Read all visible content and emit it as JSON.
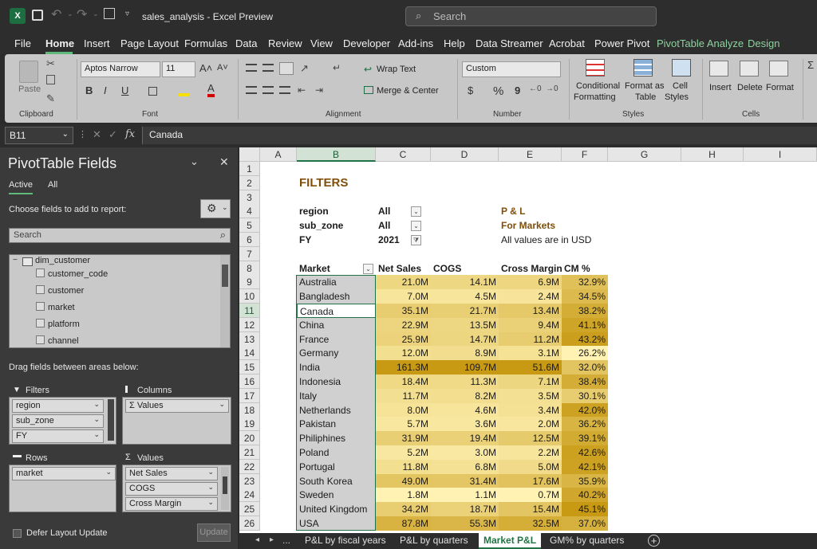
{
  "app": {
    "title": "sales_analysis  -  Excel Preview",
    "search_placeholder": "Search",
    "logo_letter": "X"
  },
  "menu": [
    "File",
    "Home",
    "Insert",
    "Page Layout",
    "Formulas",
    "Data",
    "Review",
    "View",
    "Developer",
    "Add-ins",
    "Help",
    "Data Streamer",
    "Acrobat",
    "Power Pivot",
    "PivotTable Analyze",
    "Design"
  ],
  "ribbon": {
    "clipboard": {
      "paste": "Paste",
      "group": "Clipboard"
    },
    "font": {
      "name": "Aptos Narrow",
      "size": "11",
      "bold": "B",
      "italic": "I",
      "underline": "U",
      "group": "Font"
    },
    "alignment": {
      "wrap": "Wrap Text",
      "merge": "Merge & Center",
      "group": "Alignment"
    },
    "number": {
      "format": "Custom",
      "currency": "$",
      "percent": "%",
      "comma": "9",
      "group": "Number"
    },
    "styles": {
      "conditional_1": "Conditional",
      "conditional_2": "Formatting",
      "format_table_1": "Format as",
      "format_table_2": "Table",
      "cell_styles_1": "Cell",
      "cell_styles_2": "Styles",
      "group": "Styles"
    },
    "cells": {
      "insert": "Insert",
      "delete": "Delete",
      "format": "Format",
      "group": "Cells"
    }
  },
  "formula_bar": {
    "name_box": "B11",
    "fx": "fx",
    "value": "Canada"
  },
  "pivot_pane": {
    "title": "PivotTable Fields",
    "tab_active": "Active",
    "tab_all": "All",
    "choose_label": "Choose fields to add to report:",
    "search_placeholder": "Search",
    "table_name": "dim_customer",
    "fields": [
      "customer_code",
      "customer",
      "market",
      "platform",
      "channel"
    ],
    "drag_label": "Drag fields between areas below:",
    "filters_label": "Filters",
    "columns_label": "Columns",
    "rows_label": "Rows",
    "values_label": "Values",
    "filters": [
      "region",
      "sub_zone",
      "FY"
    ],
    "columns": [
      "Values"
    ],
    "rows": [
      "market"
    ],
    "values": [
      "Net Sales",
      "COGS",
      "Cross Margin"
    ],
    "defer_label": "Defer Layout Update",
    "update_button": "Update"
  },
  "sheet": {
    "columns": [
      "A",
      "B",
      "C",
      "D",
      "E",
      "F",
      "G",
      "H",
      "I"
    ],
    "rows": [
      "1",
      "2",
      "3",
      "4",
      "5",
      "6",
      "7",
      "8",
      "9",
      "10",
      "11",
      "12",
      "13",
      "14",
      "15",
      "16",
      "17",
      "18",
      "19",
      "20",
      "21",
      "22",
      "23",
      "24",
      "25",
      "26"
    ],
    "filters_heading": "FILTERS",
    "filter_rows": [
      {
        "name": "region",
        "value": "All"
      },
      {
        "name": "sub_zone",
        "value": "All"
      },
      {
        "name": "FY",
        "value": "2021"
      }
    ],
    "pl_title": "P & L",
    "pl_subtitle": "For Markets",
    "pl_note": "All values are in USD",
    "header": {
      "market": "Market",
      "net_sales": "Net Sales",
      "cogs": "COGS",
      "cross_margin": "Cross Margin",
      "cm_pct": "CM %"
    },
    "data": [
      {
        "market": "Australia",
        "net_sales": "21.0M",
        "cogs": "14.1M",
        "cross_margin": "6.9M",
        "cm_pct": "32.9%"
      },
      {
        "market": "Bangladesh",
        "net_sales": "7.0M",
        "cogs": "4.5M",
        "cross_margin": "2.4M",
        "cm_pct": "34.5%"
      },
      {
        "market": "Canada",
        "net_sales": "35.1M",
        "cogs": "21.7M",
        "cross_margin": "13.4M",
        "cm_pct": "38.2%"
      },
      {
        "market": "China",
        "net_sales": "22.9M",
        "cogs": "13.5M",
        "cross_margin": "9.4M",
        "cm_pct": "41.1%"
      },
      {
        "market": "France",
        "net_sales": "25.9M",
        "cogs": "14.7M",
        "cross_margin": "11.2M",
        "cm_pct": "43.2%"
      },
      {
        "market": "Germany",
        "net_sales": "12.0M",
        "cogs": "8.9M",
        "cross_margin": "3.1M",
        "cm_pct": "26.2%"
      },
      {
        "market": "India",
        "net_sales": "161.3M",
        "cogs": "109.7M",
        "cross_margin": "51.6M",
        "cm_pct": "32.0%"
      },
      {
        "market": "Indonesia",
        "net_sales": "18.4M",
        "cogs": "11.3M",
        "cross_margin": "7.1M",
        "cm_pct": "38.4%"
      },
      {
        "market": "Italy",
        "net_sales": "11.7M",
        "cogs": "8.2M",
        "cross_margin": "3.5M",
        "cm_pct": "30.1%"
      },
      {
        "market": "Netherlands",
        "net_sales": "8.0M",
        "cogs": "4.6M",
        "cross_margin": "3.4M",
        "cm_pct": "42.0%"
      },
      {
        "market": "Pakistan",
        "net_sales": "5.7M",
        "cogs": "3.6M",
        "cross_margin": "2.0M",
        "cm_pct": "36.2%"
      },
      {
        "market": "Philiphines",
        "net_sales": "31.9M",
        "cogs": "19.4M",
        "cross_margin": "12.5M",
        "cm_pct": "39.1%"
      },
      {
        "market": "Poland",
        "net_sales": "5.2M",
        "cogs": "3.0M",
        "cross_margin": "2.2M",
        "cm_pct": "42.6%"
      },
      {
        "market": "Portugal",
        "net_sales": "11.8M",
        "cogs": "6.8M",
        "cross_margin": "5.0M",
        "cm_pct": "42.1%"
      },
      {
        "market": "South Korea",
        "net_sales": "49.0M",
        "cogs": "31.4M",
        "cross_margin": "17.6M",
        "cm_pct": "35.9%"
      },
      {
        "market": "Sweden",
        "net_sales": "1.8M",
        "cogs": "1.1M",
        "cross_margin": "0.7M",
        "cm_pct": "40.2%"
      },
      {
        "market": "United Kingdom",
        "net_sales": "34.2M",
        "cogs": "18.7M",
        "cross_margin": "15.4M",
        "cm_pct": "45.1%"
      },
      {
        "market": "USA",
        "net_sales": "87.8M",
        "cogs": "55.3M",
        "cross_margin": "32.5M",
        "cm_pct": "37.0%"
      }
    ]
  },
  "sheet_tabs": {
    "ellipsis": "...",
    "tabs": [
      "P&L by fiscal years",
      "P&L by quarters",
      "Market P&L",
      "GM% by quarters"
    ],
    "active": "Market P&L"
  },
  "colors": {
    "accent": "#217346",
    "brown": "#7f4f0a",
    "heat_low": "#fff2b3",
    "heat_high": "#c89a14"
  }
}
